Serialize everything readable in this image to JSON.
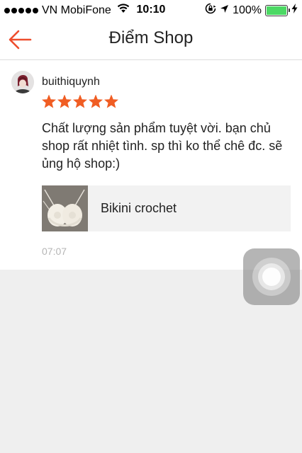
{
  "status_bar": {
    "carrier": "VN MobiFone",
    "time": "10:10",
    "battery": "100%",
    "signal_bars": 5,
    "icons": [
      "signal-dots-icon",
      "wifi-icon",
      "orientation-lock-icon",
      "location-arrow-icon",
      "battery-icon",
      "charging-bolt-icon"
    ]
  },
  "header": {
    "title": "Điểm Shop",
    "back_icon": "back-arrow-icon"
  },
  "review": {
    "username": "buithiquynh",
    "rating": 5,
    "rating_max": 5,
    "text": "Chất lượng sản phẩm tuyệt vời. bạn chủ shop rất nhiệt tình. sp thì ko thể chê đc. sẽ ủng hộ shop:)",
    "product": {
      "name": "Bikini crochet"
    },
    "time": "07:07"
  },
  "colors": {
    "accent": "#ee4d2d",
    "star": "#f05d23",
    "background": "#efefef",
    "time_text": "#b5b5b5"
  }
}
